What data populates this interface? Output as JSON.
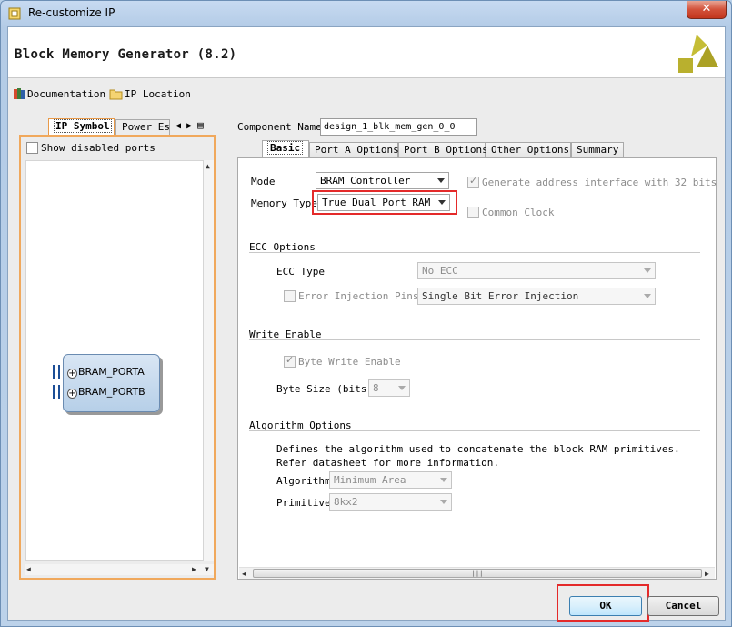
{
  "window": {
    "title": "Re-customize IP",
    "close_glyph": "✕"
  },
  "header": {
    "title": "Block Memory Generator (8.2)"
  },
  "toolbar": {
    "documentation": "Documentation",
    "ip_location": "IP Location"
  },
  "left_panel": {
    "tabs": [
      "IP Symbol",
      "Power Es"
    ],
    "show_disabled_ports": "Show disabled ports",
    "show_disabled_ports_checked": false,
    "ports": [
      "BRAM_PORTA",
      "BRAM_PORTB"
    ]
  },
  "component": {
    "label": "Component Name",
    "value": "design_1_blk_mem_gen_0_0"
  },
  "tabs": [
    "Basic",
    "Port A Options",
    "Port B Options",
    "Other Options",
    "Summary"
  ],
  "basic": {
    "mode_label": "Mode",
    "mode_value": "BRAM Controller",
    "memory_type_label": "Memory Type",
    "memory_type_value": "True Dual Port RAM",
    "gen_addr_label": "Generate address interface with 32 bits",
    "gen_addr_checked": true,
    "common_clock_label": "Common Clock",
    "common_clock_checked": false,
    "ecc_section": "ECC Options",
    "ecc_type_label": "ECC Type",
    "ecc_type_value": "No ECC",
    "error_injection_label": "Error Injection Pins",
    "error_injection_value": "Single Bit Error Injection",
    "write_enable_section": "Write Enable",
    "byte_write_label": "Byte Write Enable",
    "byte_write_checked": true,
    "byte_size_label": "Byte Size (bits)",
    "byte_size_value": "8",
    "algorithm_section": "Algorithm Options",
    "algorithm_desc_1": "Defines the algorithm used to concatenate the block RAM primitives.",
    "algorithm_desc_2": "Refer datasheet for more information.",
    "algorithm_label": "Algorithm",
    "algorithm_value": "Minimum Area",
    "primitive_label": "Primitive",
    "primitive_value": "8kx2"
  },
  "buttons": {
    "ok": "OK",
    "cancel": "Cancel"
  },
  "colors": {
    "highlight": "#e42a2a",
    "tab_accent": "#f0a85c",
    "logo": "#b5ad2a"
  }
}
